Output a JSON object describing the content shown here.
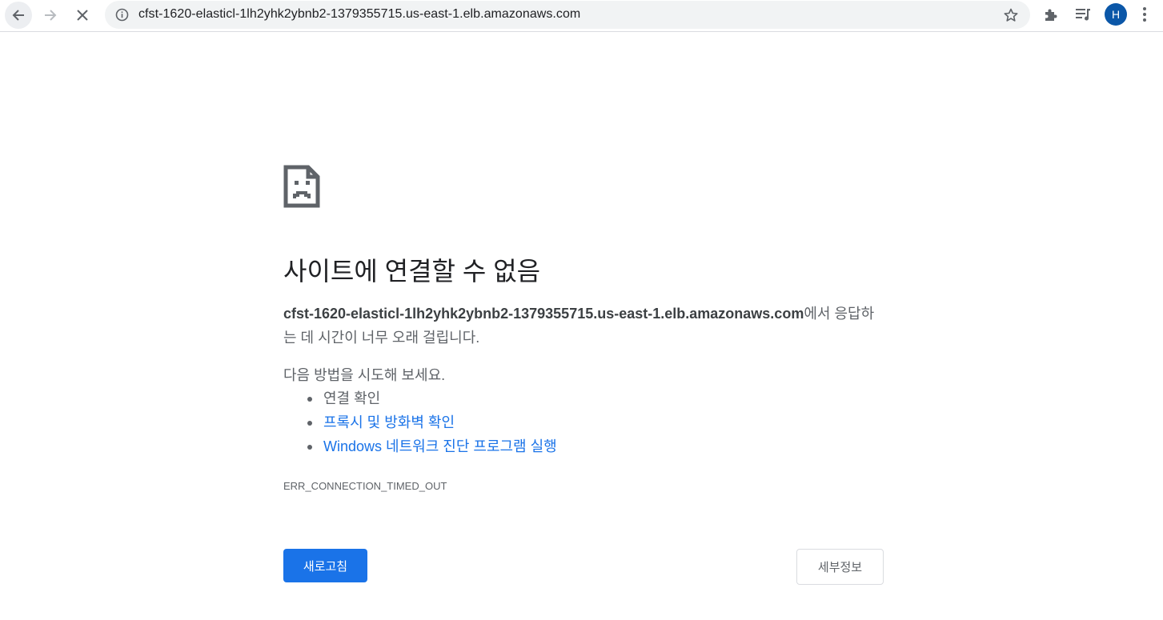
{
  "toolbar": {
    "url": "cfst-1620-elasticl-1lh2yhk2ybnb2-1379355715.us-east-1.elb.amazonaws.com",
    "profile_initial": "H",
    "icons": [
      "back-arrow-icon",
      "forward-arrow-icon",
      "stop-loading-icon",
      "site-info-icon",
      "bookmark-star-icon",
      "extensions-puzzle-icon",
      "media-control-icon",
      "kebab-menu-icon"
    ]
  },
  "error": {
    "icon": "sad-document-icon",
    "heading": "사이트에 연결할 수 없음",
    "host": "cfst-1620-elasticl-1lh2yhk2ybnb2-1379355715.us-east-1.elb.amazonaws.com",
    "desc_suffix": "에서 응답하는 데 시간이 너무 오래 걸립니다.",
    "suggest_intro": "다음 방법을 시도해 보세요.",
    "suggestions": [
      "연결 확인",
      "프록시 및 방화벽 확인",
      "Windows 네트워크 진단 프로그램 실행"
    ],
    "code": "ERR_CONNECTION_TIMED_OUT",
    "reload_label": "새로고침",
    "details_label": "세부정보"
  },
  "colors": {
    "accent": "#1a73e8",
    "text_secondary": "#5f6368",
    "avatar": "#0b57a8"
  }
}
